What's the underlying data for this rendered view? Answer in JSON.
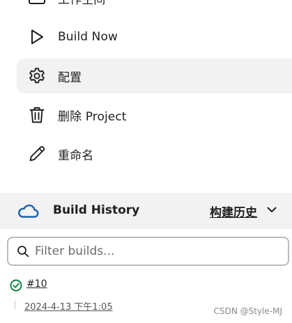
{
  "task_menu": {
    "items": [
      {
        "label": "工作空间",
        "icon": "folder-icon",
        "active": false
      },
      {
        "label": "Build Now",
        "icon": "play-icon",
        "active": false
      },
      {
        "label": "配置",
        "icon": "gear-icon",
        "active": true
      },
      {
        "label": "删除 Project",
        "icon": "trash-icon",
        "active": false
      },
      {
        "label": "重命名",
        "icon": "pencil-icon",
        "active": false
      }
    ]
  },
  "build_history": {
    "title": "Build History",
    "trend_link": "构建历史",
    "icon": "cloud-icon",
    "filter": {
      "value": "",
      "placeholder": "Filter builds..."
    },
    "builds": [
      {
        "number": "#10",
        "status": "success",
        "date": "2024-4-13 下午1:05"
      }
    ]
  },
  "colors": {
    "accent": "#1f5fa8",
    "success": "#138347",
    "active_bg": "#f2f2f2"
  },
  "watermark": "CSDN @Style-MJ"
}
